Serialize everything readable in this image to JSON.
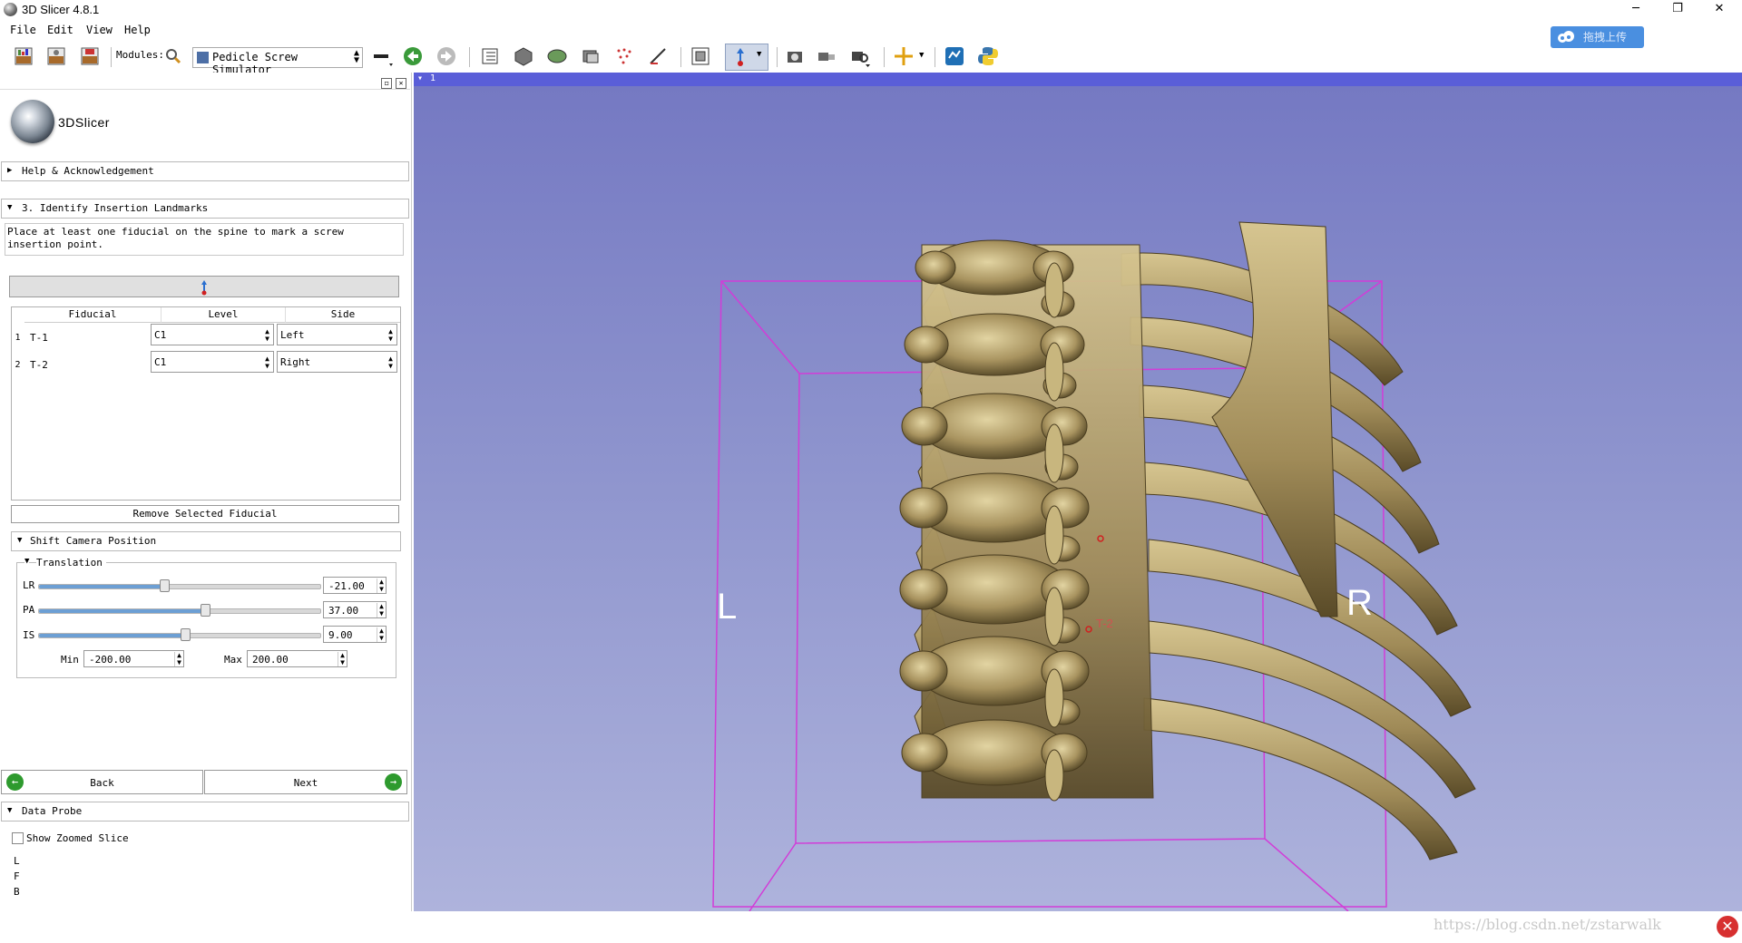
{
  "window": {
    "title": "3D Slicer 4.8.1",
    "minimize": "─",
    "maximize": "❐",
    "close": "✕"
  },
  "upload_badge": {
    "label": "拖拽上传"
  },
  "menu": [
    "File",
    "Edit",
    "View",
    "Help"
  ],
  "toolbar": {
    "modules_label": "Modules:",
    "current_module": "Pedicle Screw Simulator"
  },
  "logo_text": "3DSlicer",
  "sections": {
    "help": "Help & Acknowledgement",
    "identify": "3. Identify Insertion Landmarks",
    "shift_camera": "Shift Camera Position",
    "translation": "Translation",
    "data_probe": "Data Probe"
  },
  "instructions": "Place at least one fiducial on the spine to mark a screw insertion point.",
  "table": {
    "headers": [
      "Fiducial",
      "Level",
      "Side"
    ],
    "rows": [
      {
        "index": "1",
        "fiducial": "T-1",
        "level": "C1",
        "side": "Left"
      },
      {
        "index": "2",
        "fiducial": "T-2",
        "level": "C1",
        "side": "Right"
      }
    ]
  },
  "remove_button": "Remove Selected Fiducial",
  "translation": {
    "lr": {
      "label": "LR",
      "value": "-21.00",
      "fraction": 0.447
    },
    "pa": {
      "label": "PA",
      "value": "37.00",
      "fraction": 0.593
    },
    "is": {
      "label": "IS",
      "value": "9.00",
      "fraction": 0.522
    },
    "min_label": "Min",
    "min_value": "-200.00",
    "max_label": "Max",
    "max_value": "200.00"
  },
  "nav": {
    "back": "Back",
    "next": "Next"
  },
  "probe": {
    "show_zoomed": "Show Zoomed Slice",
    "lines": [
      "L",
      "F",
      "B"
    ]
  },
  "view": {
    "number": "1",
    "left_marker": "L",
    "right_marker": "R",
    "fiducial_label": "T-2",
    "bg_top": "#7478c2",
    "bg_bottom": "#aeb3dc",
    "box_color": "#d23cd8",
    "bone_color": "#b09c6a"
  },
  "watermark": "https://blog.csdn.net/zstarwalk"
}
